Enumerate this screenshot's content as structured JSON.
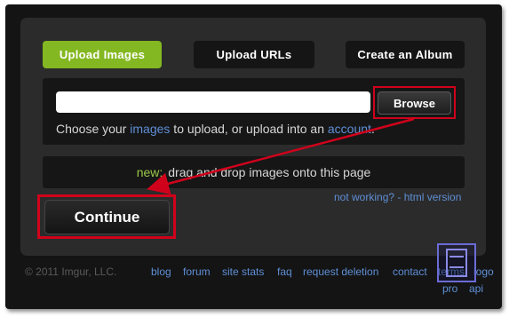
{
  "tabs": {
    "upload_images": "Upload Images",
    "upload_urls": "Upload URLs",
    "create_album": "Create an Album"
  },
  "upload": {
    "input_value": "",
    "browse_label": "Browse",
    "choose_prefix": "Choose your ",
    "choose_images_link": "images",
    "choose_middle": " to upload, or upload into an ",
    "choose_account_link": "account",
    "choose_suffix": "."
  },
  "dragdrop": {
    "new_label": "new:",
    "text": "drag and drop images onto this page"
  },
  "not_working": "not working? - html version",
  "continue_label": "Continue",
  "footer": {
    "copyright": "© 2011 Imgur, LLC.",
    "links": [
      "blog",
      "forum",
      "site stats",
      "faq",
      "request deletion",
      "contact",
      "terms",
      "logo",
      "pro",
      "api"
    ]
  },
  "colors": {
    "accent_green": "#84b822",
    "link_blue": "#5f8fd6",
    "annotation_red": "#d0021b"
  }
}
